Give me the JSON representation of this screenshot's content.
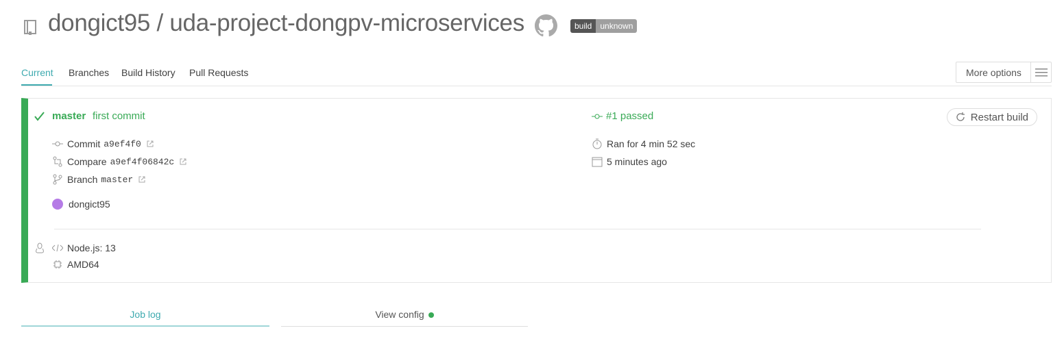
{
  "header": {
    "repo_title": "dongict95 / uda-project-dongpv-microservices",
    "badge_left": "build",
    "badge_right": "unknown"
  },
  "tabs": [
    {
      "label": "Current",
      "active": true
    },
    {
      "label": "Branches",
      "active": false
    },
    {
      "label": "Build History",
      "active": false
    },
    {
      "label": "Pull Requests",
      "active": false
    }
  ],
  "more_options": "More options",
  "build": {
    "status_color": "#39aa56",
    "branch": "master",
    "commit_message": "first commit",
    "commit_label": "Commit",
    "commit_sha": "a9ef4f0",
    "compare_label": "Compare",
    "compare_sha": "a9ef4f06842c",
    "branch_label": "Branch",
    "branch_value": "master",
    "author": "dongict95",
    "build_status": "#1 passed",
    "duration": "Ran for 4 min 52 sec",
    "finished": "5 minutes ago",
    "restart_label": "Restart build",
    "language": "Node.js: 13",
    "arch": "AMD64"
  },
  "bottom_tabs": {
    "job_log": "Job log",
    "view_config": "View config"
  }
}
